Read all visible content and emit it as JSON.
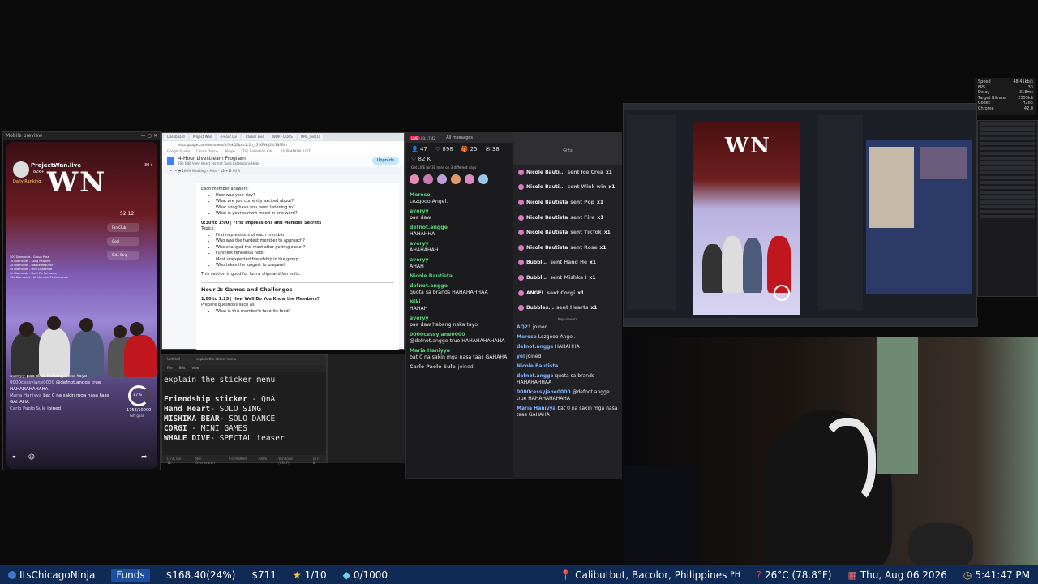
{
  "stats_overlay": {
    "rows": [
      {
        "label": "Speed",
        "value": "48.41kb/s"
      },
      {
        "label": "FPS",
        "value": "33"
      },
      {
        "label": "Delay",
        "value": "318ms"
      },
      {
        "label": "Target Bitrate",
        "value": "2355kb"
      },
      {
        "label": "Codec",
        "value": "H265"
      },
      {
        "label": "Chrome",
        "value": "42.0"
      }
    ]
  },
  "mobile": {
    "window_title": "Mobile preview",
    "channel_name": "ProjectWan.live",
    "followers": "82k+",
    "daily_ranking": "Daily Ranking",
    "viewer_count": "30+",
    "logo": "WN",
    "timer": "52:12",
    "menu": [
      "Fan Club",
      "Goal",
      "Side Strip"
    ],
    "tiers": [
      "500 Diamonds - Group Pose",
      "1k Diamonds - Song Request",
      "2k Diamonds - Dance Request",
      "5k Diamonds - Mini Challenge",
      "7k Diamonds - Duet Performance",
      "10k Diamonds - All Member Performance"
    ],
    "goal_percent": "17%",
    "goal_count": "1768",
    "goal_total": "10000",
    "goal_label": "Gift goal",
    "comments": [
      {
        "user": "averyy",
        "text": "paa daw habang naka tayo"
      },
      {
        "user": "0000cessyjane0000",
        "text": "@defnot.angge true HAHAHAHAHAHA"
      },
      {
        "user": "Maria Haniyya",
        "text": "bat 0 na sakin mga nasa taas GAHAHA"
      },
      {
        "user": "Carlo Paolo Sule",
        "text": "joined"
      }
    ]
  },
  "docs": {
    "tabs": [
      "Dashboard",
      "Project Wan",
      "4-Hour Liv",
      "Tracker Live",
      "WDP - DOCS",
      "OPD_live(1)"
    ],
    "url": "docs.google.com/document/d/1ekQZlpcz1c2h_c3_KRWq3Vt3NSBm",
    "bookmarks": [
      "Google Studio",
      "Canva Dance",
      "Pikapo",
      "[TH] Collection Alb...",
      "[SURMAKAN] LIST"
    ],
    "doc_title": "4-Hour Livestream Program",
    "menus": "File  Edit  View  Insert  Format  Tools  Extensions  Help",
    "share_button": "Upgrade",
    "intro": "Each member answers:",
    "questions1": [
      "How was your day?",
      "What are you currently excited about?",
      "What song have you been listening to?",
      "What is your current mood in one word?"
    ],
    "section2_title": "0:30 to 1:00 | First Impressions and Member Secrets",
    "section2_topics": "Topics:",
    "questions2": [
      "First impressions of each member",
      "Who was the hardest member to approach?",
      "Who changed the most after getting closer?",
      "Funniest rehearsal habit",
      "Most unexpected friendship in the group",
      "Who takes the longest to prepare?"
    ],
    "section2_note": "This section is good for funny clips and fan edits.",
    "hour2_title": "Hour 2: Games and Challenges",
    "section3_title": "1:00 to 1:25 | How Well Do You Know the Members?",
    "section3_sub": "Prepare questions such as:",
    "questions3": [
      "What is this member's favorite food?"
    ]
  },
  "notepad": {
    "tabs": [
      "Untitled",
      "explain the sticker menu"
    ],
    "menus": [
      "File",
      "Edit",
      "View"
    ],
    "lines": [
      {
        "prefix": "explain the sticker menu",
        "rest": ""
      },
      {
        "prefix": "",
        "rest": ""
      },
      {
        "prefix": "Friendship sticker",
        "rest": " - QnA"
      },
      {
        "prefix": "Hand Heart",
        "rest": "- SOLO SING"
      },
      {
        "prefix": "MISHIKA BEAR",
        "rest": "- SOLO DANCE"
      },
      {
        "prefix": "CORGI",
        "rest": " - MINI GAMES"
      },
      {
        "prefix": "WHALE DIVE",
        "rest": "- SPECIAL teaser"
      }
    ],
    "status": [
      "Ln 4, Col 12",
      "Not Overwritten",
      "Formatted",
      "100%",
      "Windows (CRLF)",
      "UTF-8"
    ]
  },
  "chat": {
    "live_time": "03:17:42",
    "header": "All messages",
    "viewers": "47",
    "likes": "898",
    "gifts": "25",
    "comments": "38",
    "likes_total": "82 K",
    "promo": "Get LIVE for 30 mins on 3 different days",
    "messages": [
      {
        "user": "Merose",
        "text": "Lezgooo Angel.",
        "type": "msg"
      },
      {
        "user": "averyy",
        "text": "paa daw",
        "type": "msg"
      },
      {
        "user": "defnot.angge",
        "text": "HAHAHHA",
        "type": "msg"
      },
      {
        "user": "averyy",
        "text": "AHAHAHAH",
        "type": "msg"
      },
      {
        "user": "averyy",
        "text": "AHAH",
        "type": "msg"
      },
      {
        "user": "Nicole Bautista",
        "text": "",
        "type": "msg"
      },
      {
        "user": "defnot.angge",
        "text": "quota sa brands HAHAHAHHAA",
        "type": "msg"
      },
      {
        "user": "Niki",
        "text": "HAHAH",
        "type": "msg"
      },
      {
        "user": "averyy",
        "text": "paa daw habang naka tayo",
        "type": "msg"
      },
      {
        "user": "0000cessyjane0000",
        "text": "@defnot.angge true HAHAHAHAHAHA",
        "type": "msg"
      },
      {
        "user": "Maria Haniyya",
        "text": "bat 0 na sakin mga nasa taas GAHAHA",
        "type": "msg"
      },
      {
        "user": "Carlo Paolo Sule",
        "text": "joined",
        "type": "join"
      }
    ]
  },
  "gifts_panel": {
    "header": "Gifts",
    "gifts": [
      {
        "user": "Nicole Bauti...",
        "action": "sent Ice Crea",
        "count": "x1"
      },
      {
        "user": "Nicole Bauti...",
        "action": "sent Wink win",
        "count": "x1"
      },
      {
        "user": "Nicole Bautista",
        "action": "sent Pop",
        "count": "x1"
      },
      {
        "user": "Nicole Bautista",
        "action": "sent Fire",
        "count": "x1"
      },
      {
        "user": "Nicole Bautista",
        "action": "sent TikTok",
        "count": "x1"
      },
      {
        "user": "Nicole Bautista",
        "action": "sent Rose",
        "count": "x1"
      },
      {
        "user": "Bubbl...",
        "action": "sent Hand He",
        "count": "x1"
      },
      {
        "user": "Bubbl...",
        "action": "sent Mishka I",
        "count": "x1"
      },
      {
        "user": "ANGEL",
        "action": "sent Corgi",
        "count": "x1"
      },
      {
        "user": "Bubbles...",
        "action": "sent Hearts",
        "count": "x1"
      }
    ],
    "key_viewers": "Key viewers",
    "feed": [
      {
        "user": "AQ21",
        "text": "joined"
      },
      {
        "user": "Merose",
        "text": "Lezgooo Angel."
      },
      {
        "user": "defnot.angge",
        "text": "HAHAHHA"
      },
      {
        "user": "yel",
        "text": "joined"
      },
      {
        "user": "Nicole Bautista",
        "text": ""
      },
      {
        "user": "defnot.angge",
        "text": "quota sa brands HAHAHAHHAA"
      },
      {
        "user": "0000cessyjane0000",
        "text": "@defnot.angge true HAHAHAHAHAHA"
      },
      {
        "user": "Maria Haniyya",
        "text": "bat 0 na sakin mga nasa taas GAHAHA"
      }
    ]
  },
  "obs": {
    "logo": "WN"
  },
  "ticker": {
    "channel": "ItsChicagoNinja",
    "funds_label": "Funds",
    "funds_value": "$168.40(24%)",
    "amount": "$711",
    "stars": "1/10",
    "diamonds": "0/1000",
    "location": "Calibutbut, Bacolor, Philippines",
    "country": "PH",
    "weather": "26°C (78.8°F)",
    "date": "Thu, Aug 06 2026",
    "time": "5:41:47 PM"
  }
}
